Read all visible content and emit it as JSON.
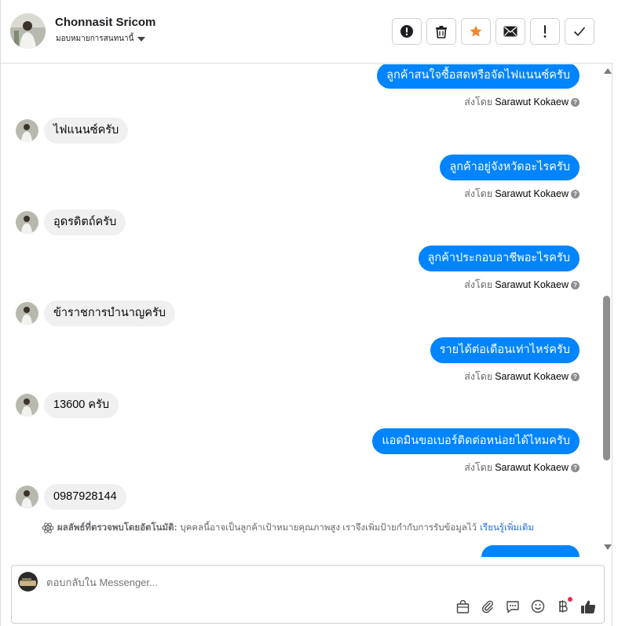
{
  "header": {
    "name": "Chonnasit Sricom",
    "assign_label": "มอบหมายการสนทนานี้",
    "toolbar": [
      {
        "icon": "alert-circle-icon",
        "name": "mark-spam-button"
      },
      {
        "icon": "trash-icon",
        "name": "delete-button"
      },
      {
        "icon": "star-icon",
        "name": "star-button"
      },
      {
        "icon": "mail-icon",
        "name": "mark-unread-button"
      },
      {
        "icon": "exclamation-icon",
        "name": "follow-up-button"
      },
      {
        "icon": "check-icon",
        "name": "mark-done-button"
      }
    ]
  },
  "colors": {
    "outgoing_bubble": "#0084ff",
    "incoming_bubble": "#f0f0f0",
    "star": "#f5862a"
  },
  "messages": [
    {
      "dir": "out",
      "text": "ลูกค้าสนใจซื้อสดหรือจัดไฟแนนซ์ครับ",
      "sent_by_prefix": "ส่งโดย",
      "sender": "Sarawut Kokaew"
    },
    {
      "dir": "in",
      "text": "ไฟแนนซ์ครับ"
    },
    {
      "dir": "out",
      "text": "ลูกค้าอยู่จังหวัดอะไรครับ",
      "sent_by_prefix": "ส่งโดย",
      "sender": "Sarawut Kokaew"
    },
    {
      "dir": "in",
      "text": "อุดรดิตถ์ครับ"
    },
    {
      "dir": "out",
      "text": "ลูกค้าประกอบอาชีพอะไรครับ",
      "sent_by_prefix": "ส่งโดย",
      "sender": "Sarawut Kokaew"
    },
    {
      "dir": "in",
      "text": "ข้าราชการบำนาญครับ"
    },
    {
      "dir": "out",
      "text": "รายได้ต่อเดือนเท่าไหร่ครับ",
      "sent_by_prefix": "ส่งโดย",
      "sender": "Sarawut Kokaew"
    },
    {
      "dir": "in",
      "text": "13600 ครับ"
    },
    {
      "dir": "out",
      "text": "แอดมินขอเบอร์ติดต่อหน่อยได้ไหมครับ",
      "sent_by_prefix": "ส่งโดย",
      "sender": "Sarawut Kokaew"
    },
    {
      "dir": "in",
      "text": "0987928144"
    }
  ],
  "ai_note": {
    "title": "ผลลัพธ์ที่ตรวจพบโดยอัตโนมัติ:",
    "text": "บุคคลนี้อาจเป็นลูกค้าเป้าหมายคุณภาพสูง เราจึงเพิ่มป้ายกำกับการรับข้อมูลไว้",
    "link": "เรียนรู้เพิ่มเติม"
  },
  "composer": {
    "placeholder": "ตอบกลับใน Messenger...",
    "actions": [
      "bag-icon",
      "paperclip-icon",
      "saved-reply-icon",
      "emoji-icon",
      "baht-payment-icon",
      "thumbs-up-icon"
    ]
  }
}
